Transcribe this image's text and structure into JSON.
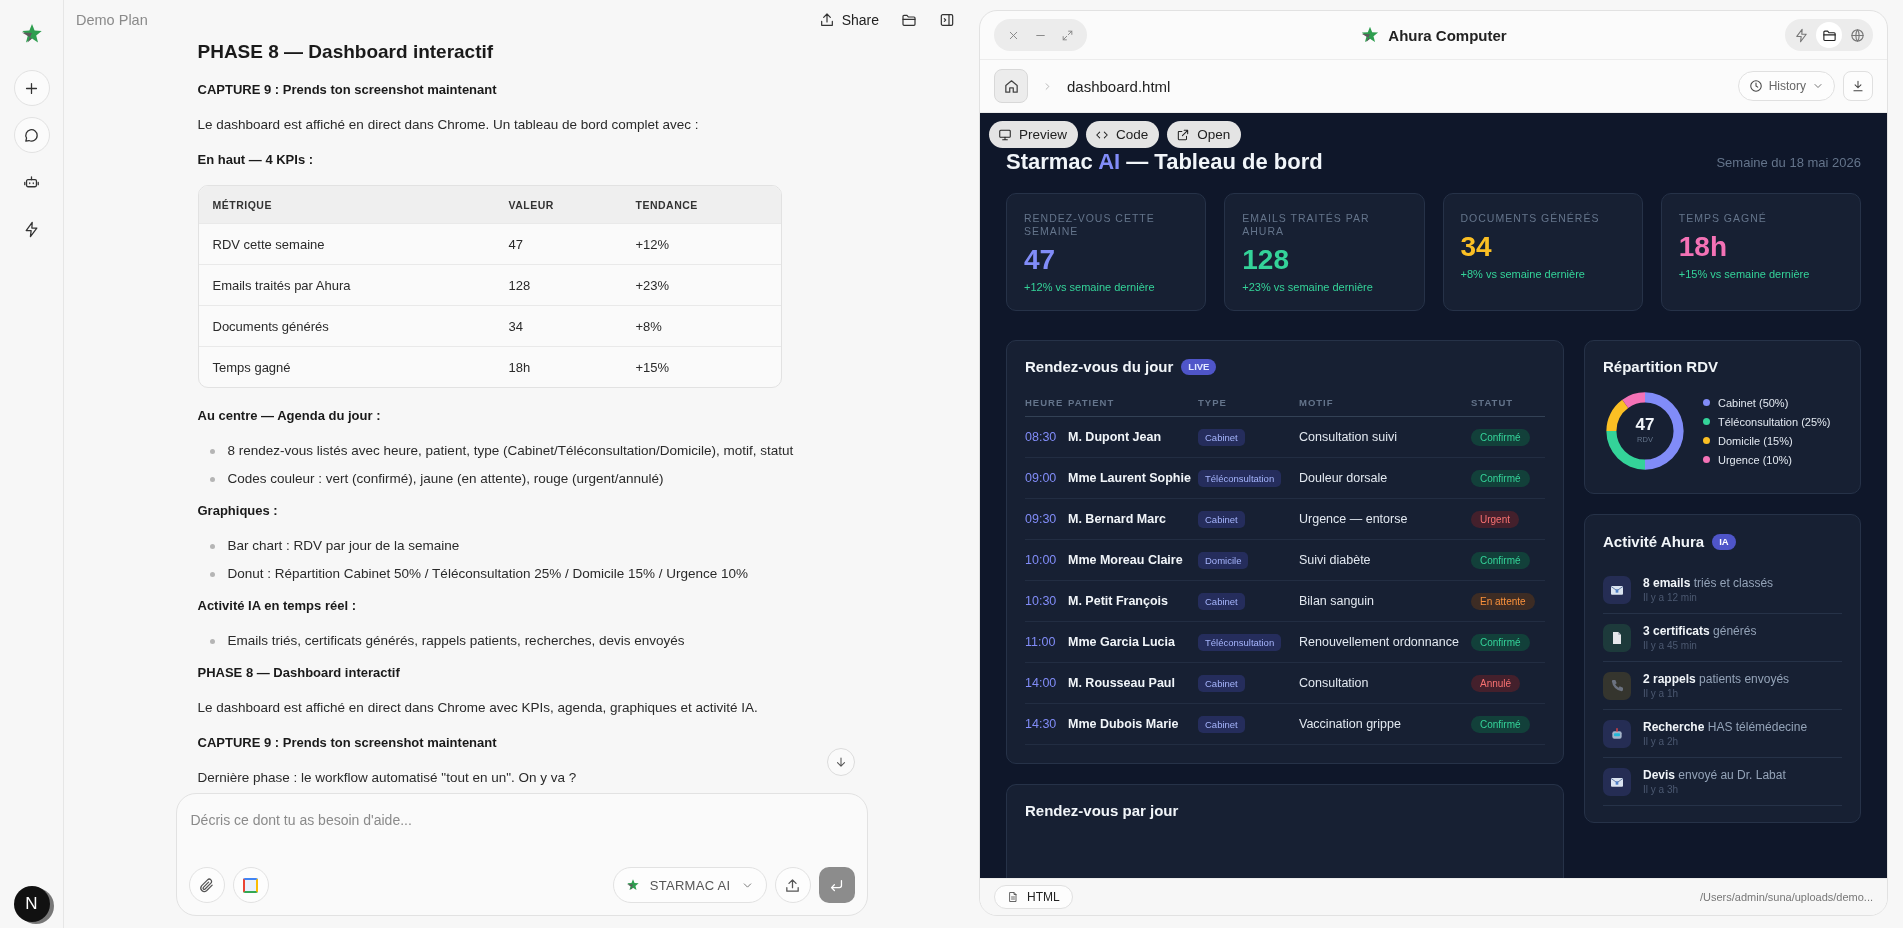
{
  "sidebar": {
    "items": [
      {
        "kind": "new"
      },
      {
        "kind": "chat"
      },
      {
        "kind": "agent"
      },
      {
        "kind": "bolt"
      }
    ],
    "avatar": "N"
  },
  "chat": {
    "title": "Demo Plan",
    "actions": [
      {
        "kind": "share",
        "label": "Share"
      },
      {
        "kind": "folder"
      },
      {
        "kind": "panel"
      }
    ],
    "blocks": [
      {
        "kind": "heading",
        "text": "PHASE 8 — Dashboard interactif"
      },
      {
        "kind": "strong",
        "text": "CAPTURE 9 : Prends ton screenshot maintenant"
      },
      {
        "kind": "paragraph",
        "text": "Le dashboard est affiché en direct dans Chrome. Un tableau de bord complet avec :"
      },
      {
        "kind": "strong",
        "text": "En haut — 4 KPIs :"
      },
      {
        "kind": "table",
        "columns": [
          "MÉTRIQUE",
          "VALEUR",
          "TENDANCE"
        ],
        "rows": [
          [
            "RDV cette semaine",
            "47",
            "+12%"
          ],
          [
            "Emails traités par Ahura",
            "128",
            "+23%"
          ],
          [
            "Documents générés",
            "34",
            "+8%"
          ],
          [
            "Temps gagné",
            "18h",
            "+15%"
          ]
        ]
      },
      {
        "kind": "strong",
        "text": "Au centre — Agenda du jour :"
      },
      {
        "kind": "bullets",
        "items": [
          "8 rendez-vous listés avec heure, patient, type (Cabinet/Téléconsultation/Domicile), motif, statut",
          "Codes couleur : vert (confirmé), jaune (en attente), rouge (urgent/annulé)"
        ]
      },
      {
        "kind": "strong",
        "text": "Graphiques :"
      },
      {
        "kind": "bullets",
        "items": [
          "Bar chart : RDV par jour de la semaine",
          "Donut : Répartition Cabinet 50% / Téléconsultation 25% / Domicile 15% / Urgence 10%"
        ]
      },
      {
        "kind": "strong",
        "text": "Activité IA en temps réel :"
      },
      {
        "kind": "bullets",
        "items": [
          "Emails triés, certificats générés, rappels patients, recherches, devis envoyés"
        ]
      },
      {
        "kind": "strong",
        "text": "PHASE 8 — Dashboard interactif"
      },
      {
        "kind": "paragraph",
        "text": "Le dashboard est affiché en direct dans Chrome avec KPIs, agenda, graphiques et activité IA."
      },
      {
        "kind": "strong",
        "text": "CAPTURE 9 : Prends ton screenshot maintenant"
      },
      {
        "kind": "paragraph",
        "text": "Dernière phase : le workflow automatisé \"tout en un\". On y va ?"
      }
    ],
    "composer": {
      "placeholder": "Décris ce dont tu as besoin d'aide...",
      "model": "STARMAC AI"
    }
  },
  "computer": {
    "title": "Ahura Computer",
    "window_controls": [
      {
        "kind": "close"
      },
      {
        "kind": "minimize"
      },
      {
        "kind": "expand"
      }
    ],
    "views": [
      {
        "kind": "bolt",
        "selected": false
      },
      {
        "kind": "folder",
        "selected": true
      },
      {
        "kind": "globe",
        "selected": false
      }
    ],
    "file": "dashboard.html",
    "history": "History",
    "modes": [
      {
        "kind": "preview",
        "label": "Preview"
      },
      {
        "kind": "code",
        "label": "Code"
      },
      {
        "kind": "open",
        "label": "Open"
      }
    ],
    "file_type": "HTML",
    "path": "/Users/admin/suna/uploads/demo..."
  },
  "dashboard": {
    "title": {
      "lead": "Starmac",
      "accent": "AI",
      "rest": "— Tableau de bord"
    },
    "week": "Semaine du 18 mai 2026",
    "kpis": [
      {
        "label": "RENDEZ-VOUS CETTE SEMAINE",
        "value": "47",
        "trend": "+12% vs semaine dernière",
        "color": "#818cf8"
      },
      {
        "label": "EMAILS TRAITÉS PAR AHURA",
        "value": "128",
        "trend": "+23% vs semaine dernière",
        "color": "#34d399"
      },
      {
        "label": "DOCUMENTS GÉNÉRÉS",
        "value": "34",
        "trend": "+8% vs semaine dernière",
        "color": "#fbbf24"
      },
      {
        "label": "TEMPS GAGNÉ",
        "value": "18h",
        "trend": "+15% vs semaine dernière",
        "color": "#f472b6"
      }
    ],
    "agenda": {
      "title": "Rendez-vous du jour",
      "badge": "LIVE",
      "columns": [
        "HEURE",
        "PATIENT",
        "TYPE",
        "MOTIF",
        "STATUT"
      ],
      "rows": [
        {
          "time": "08:30",
          "patient": "M. Dupont Jean",
          "type": "Cabinet",
          "motif": "Consultation suivi",
          "status": "Confirmé",
          "kind": "confirmed"
        },
        {
          "time": "09:00",
          "patient": "Mme Laurent Sophie",
          "type": "Téléconsultation",
          "motif": "Douleur dorsale",
          "status": "Confirmé",
          "kind": "confirmed"
        },
        {
          "time": "09:30",
          "patient": "M. Bernard Marc",
          "type": "Cabinet",
          "motif": "Urgence — entorse",
          "status": "Urgent",
          "kind": "urgent"
        },
        {
          "time": "10:00",
          "patient": "Mme Moreau Claire",
          "type": "Domicile",
          "motif": "Suivi diabète",
          "status": "Confirmé",
          "kind": "confirmed"
        },
        {
          "time": "10:30",
          "patient": "M. Petit François",
          "type": "Cabinet",
          "motif": "Bilan sanguin",
          "status": "En attente",
          "kind": "pending"
        },
        {
          "time": "11:00",
          "patient": "Mme Garcia Lucia",
          "type": "Téléconsultation",
          "motif": "Renouvellement ordonnance",
          "status": "Confirmé",
          "kind": "confirmed"
        },
        {
          "time": "14:00",
          "patient": "M. Rousseau Paul",
          "type": "Cabinet",
          "motif": "Consultation",
          "status": "Annulé",
          "kind": "cancelled"
        },
        {
          "time": "14:30",
          "patient": "Mme Dubois Marie",
          "type": "Cabinet",
          "motif": "Vaccination grippe",
          "status": "Confirmé",
          "kind": "confirmed"
        }
      ]
    },
    "distribution": {
      "title": "Répartition RDV",
      "center_value": "47",
      "center_label": "RDV",
      "legend": [
        {
          "color": "#818cf8"
        },
        {
          "color": "#34d399"
        },
        {
          "color": "#fbbf24"
        },
        {
          "color": "#f472b6"
        }
      ],
      "chart_data": {
        "type": "donut",
        "categories": [
          "Cabinet (50%)",
          "Téléconsultation (25%)",
          "Domicile (15%)",
          "Urgence (10%)"
        ],
        "values": [
          50,
          25,
          15,
          10
        ]
      }
    },
    "activity": {
      "title": "Activité Ahura",
      "badge": "IA",
      "items": [
        {
          "kind": "email",
          "text": "**8 emails** triés et classés",
          "time": "Il y a 12 min"
        },
        {
          "kind": "document",
          "text": "**3 certificats** générés",
          "time": "Il y a 45 min"
        },
        {
          "kind": "phone",
          "text": "**2 rappels** patients envoyés",
          "time": "Il y a 1h"
        },
        {
          "kind": "robot",
          "text": "**Recherche** HAS télémédecine",
          "time": "Il y a 2h"
        },
        {
          "kind": "email",
          "text": "**Devis** envoyé au Dr. Labat",
          "time": "Il y a 3h"
        }
      ]
    },
    "daily": {
      "title": "Rendez-vous par jour"
    }
  }
}
